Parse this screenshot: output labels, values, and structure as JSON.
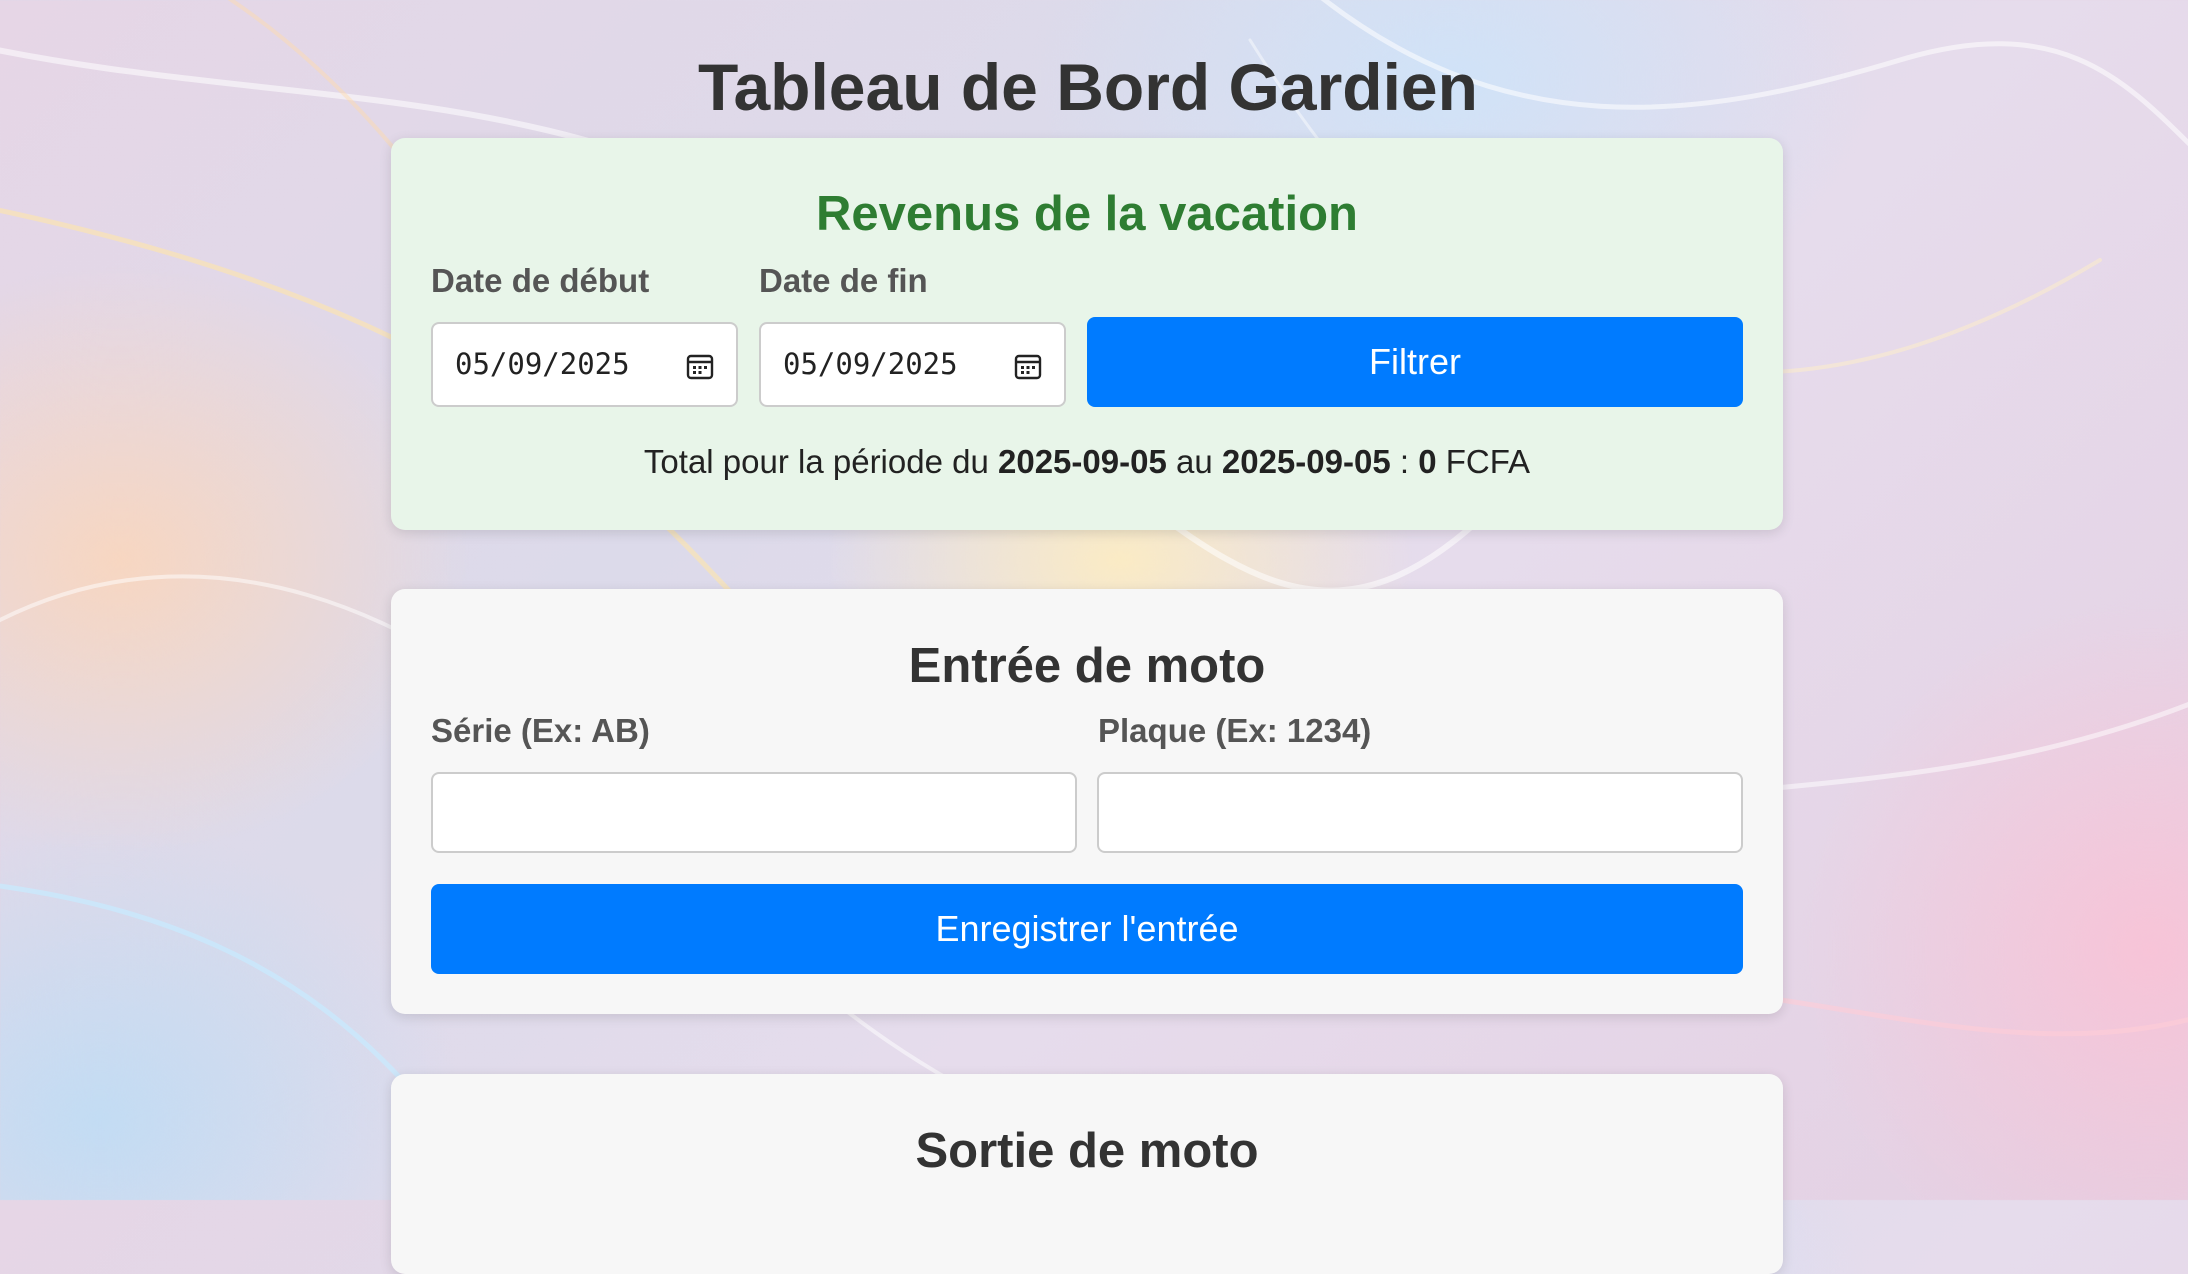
{
  "page_title": "Tableau de Bord Gardien",
  "revenue": {
    "heading": "Revenus de la vacation",
    "start_label": "Date de début",
    "end_label": "Date de fin",
    "start_value": "05/09/2025",
    "end_value": "05/09/2025",
    "filter_label": "Filtrer",
    "total": {
      "prefix": "Total pour la période du",
      "from": "2025-09-05",
      "mid": "au",
      "to": "2025-09-05",
      "colon": ":",
      "amount": "0",
      "currency": "FCFA"
    }
  },
  "entry": {
    "heading": "Entrée de moto",
    "series_label": "Série (Ex: AB)",
    "series_value": "",
    "plate_label": "Plaque (Ex: 1234)",
    "plate_value": "",
    "submit_label": "Enregistrer l'entrée"
  },
  "exit": {
    "heading": "Sortie de moto"
  },
  "icons": {
    "calendar": "calendar-icon"
  },
  "colors": {
    "primary_button": "#007bff",
    "revenue_heading": "#2e7d32",
    "revenue_card_bg": "#e8f5e9",
    "card_bg": "#f7f7f7"
  }
}
